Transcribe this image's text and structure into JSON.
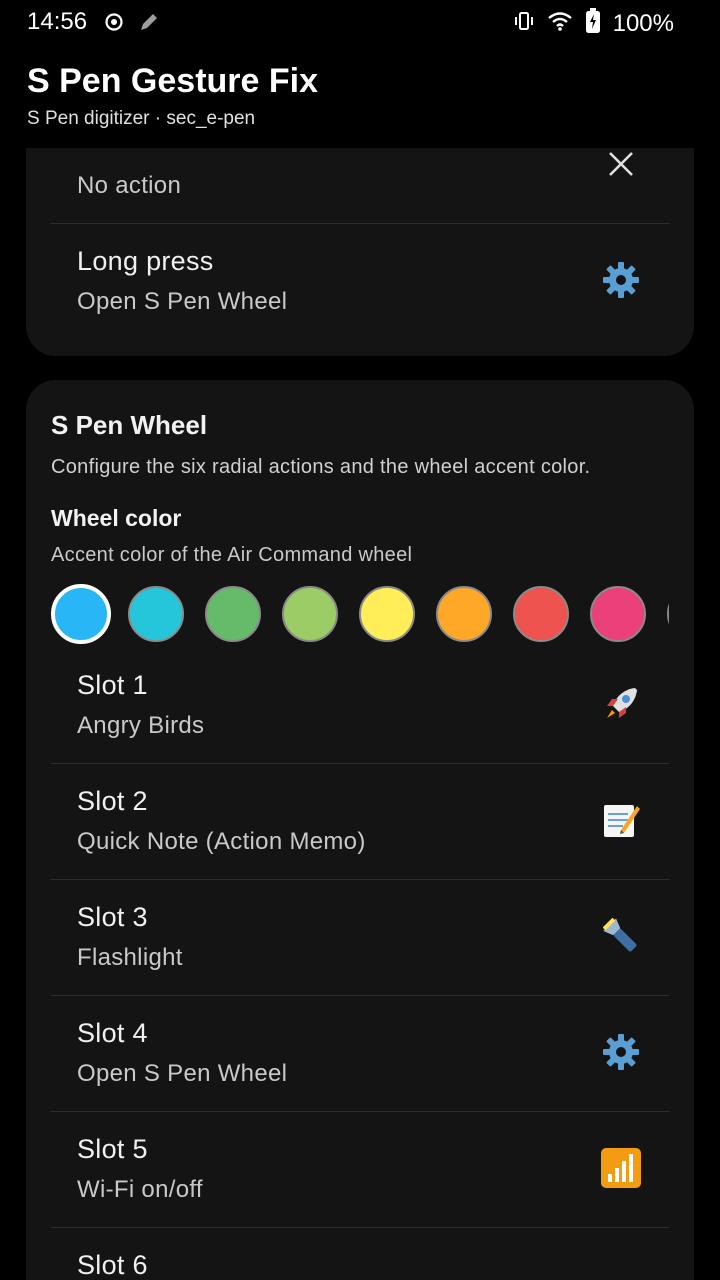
{
  "status_bar": {
    "time": "14:56",
    "battery_percent": "100%",
    "icons": [
      "record-icon",
      "pen-icon",
      "vibrate-icon",
      "wifi-icon",
      "battery-charging-icon"
    ]
  },
  "app_bar": {
    "title": "S Pen Gesture Fix",
    "subtitle": "S Pen digitizer · sec_e-pen"
  },
  "gesture_card": {
    "rows": [
      {
        "title": "",
        "value": "No action",
        "icon": "close-icon"
      },
      {
        "title": "Long press",
        "value": "Open S Pen Wheel",
        "icon": "gear-icon"
      }
    ]
  },
  "wheel_card": {
    "title": "S Pen Wheel",
    "description": "Configure the six radial actions and the wheel accent color.",
    "wheel_color_label": "Wheel color",
    "wheel_color_desc": "Accent color of the Air Command wheel",
    "colors": [
      "#29b6f6",
      "#26c6da",
      "#66bb6a",
      "#9ccc65",
      "#ffee58",
      "#ffa726",
      "#ef5350",
      "#ec407a",
      "#ab47bc"
    ],
    "selected_color": "#29b6f6",
    "slots": [
      {
        "title": "Slot 1",
        "value": "Angry Birds",
        "icon": "rocket-icon"
      },
      {
        "title": "Slot 2",
        "value": "Quick Note (Action Memo)",
        "icon": "memo-icon"
      },
      {
        "title": "Slot 3",
        "value": "Flashlight",
        "icon": "flashlight-icon"
      },
      {
        "title": "Slot 4",
        "value": "Open S Pen Wheel",
        "icon": "gear-icon"
      },
      {
        "title": "Slot 5",
        "value": "Wi-Fi on/off",
        "icon": "signal-bars-icon"
      },
      {
        "title": "Slot 6",
        "value": "",
        "icon": ""
      }
    ]
  }
}
